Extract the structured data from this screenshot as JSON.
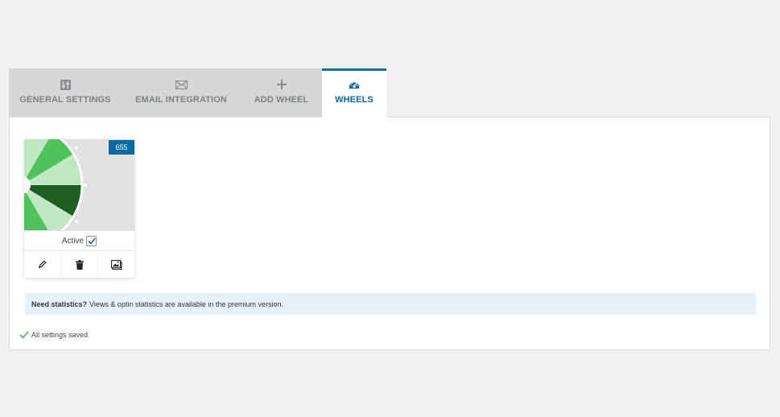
{
  "tabs": [
    {
      "label": "GENERAL SETTINGS",
      "icon": "settings-sliders-icon",
      "active": false
    },
    {
      "label": "EMAIL INTEGRATION",
      "icon": "envelope-icon",
      "active": false
    },
    {
      "label": "ADD WHEEL",
      "icon": "plus-icon",
      "active": false
    },
    {
      "label": "WHEELS",
      "icon": "dashboard-gauge-icon",
      "active": true
    }
  ],
  "wheel_card": {
    "id": "655",
    "status_label": "Active",
    "active": true,
    "actions": [
      "pencil-icon",
      "trash-icon",
      "preview-image-icon"
    ],
    "segment_colors": [
      "#4fc35a",
      "#bfe8c2",
      "#1f5e23",
      "#bfe8c2",
      "#4fc35a"
    ]
  },
  "notice": {
    "bold": "Need statistics?",
    "text": "Views & optin statistics are available in the premium version."
  },
  "status": {
    "text": "All settings saved",
    "color": "#46b450"
  },
  "colors": {
    "accent": "#0073aa",
    "tab_inactive": "#d5d7d6",
    "notice_bg": "#e8f1f8"
  }
}
